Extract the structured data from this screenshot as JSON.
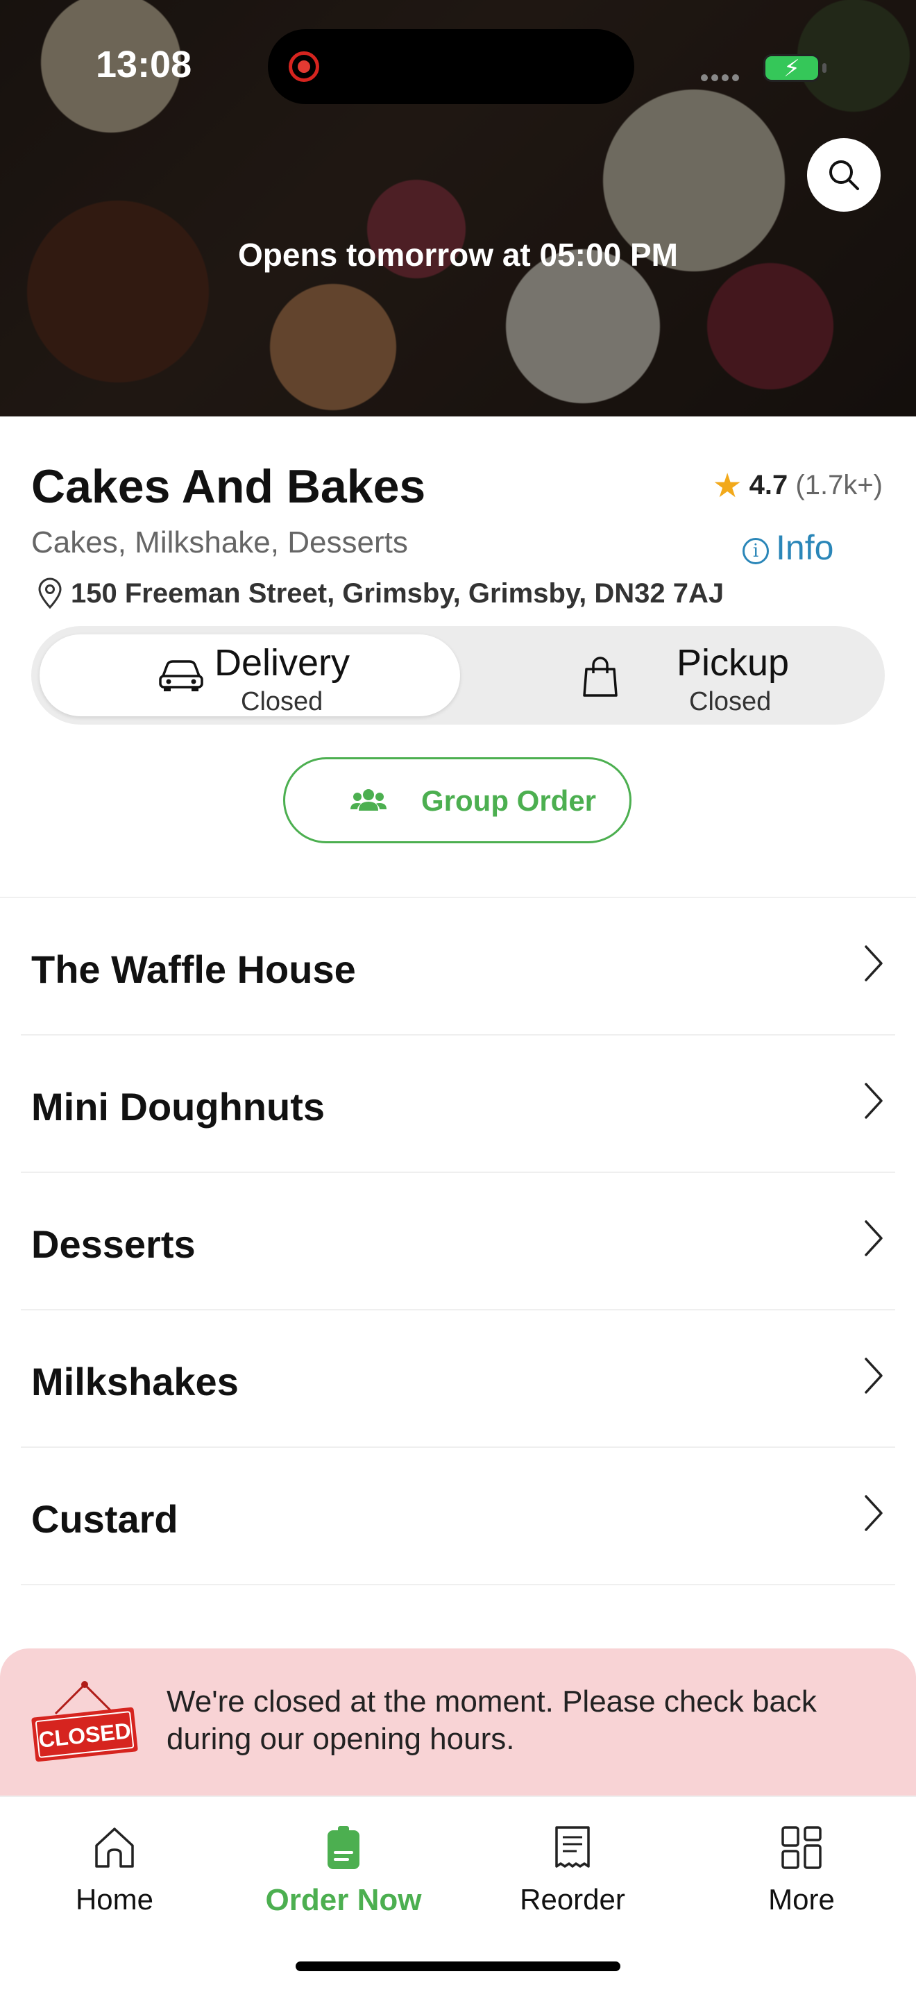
{
  "status_bar": {
    "time": "13:08"
  },
  "hero": {
    "opening_text": "Opens tomorrow at 05:00 PM"
  },
  "restaurant": {
    "name": "Cakes And Bakes",
    "rating": "4.7",
    "rating_count": "(1.7k+)",
    "cuisines": "Cakes, Milkshake, Desserts",
    "info_label": "Info",
    "address": "150 Freeman Street, Grimsby, Grimsby, DN32 7AJ"
  },
  "order_mode": {
    "delivery": {
      "label": "Delivery",
      "status": "Closed",
      "selected": true
    },
    "pickup": {
      "label": "Pickup",
      "status": "Closed",
      "selected": false
    }
  },
  "group_order": {
    "label": "Group Order"
  },
  "menu_categories": [
    {
      "label": "The Waffle House"
    },
    {
      "label": "Mini Doughnuts"
    },
    {
      "label": "Desserts"
    },
    {
      "label": "Milkshakes"
    },
    {
      "label": "Custard"
    }
  ],
  "closed_banner": {
    "sign_text": "CLOSED",
    "message": "We're closed at the moment. Please check back during our opening hours."
  },
  "tabbar": {
    "items": [
      {
        "label": "Home",
        "icon": "home-icon",
        "active": false
      },
      {
        "label": "Order Now",
        "icon": "order-icon",
        "active": true
      },
      {
        "label": "Reorder",
        "icon": "receipt-icon",
        "active": false
      },
      {
        "label": "More",
        "icon": "grid-icon",
        "active": false
      }
    ]
  },
  "colors": {
    "accent_green": "#4caf50",
    "info_blue": "#2a86b8",
    "star_yellow": "#f2a91b",
    "closed_banner_bg": "#f8d3d5",
    "closed_sign_red": "#d6241f"
  }
}
